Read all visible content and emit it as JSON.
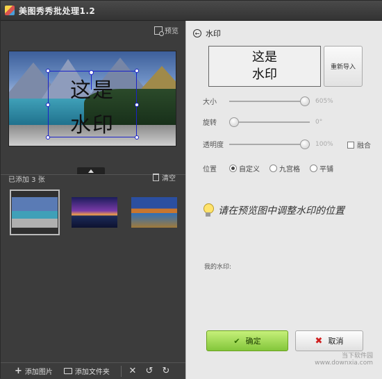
{
  "window": {
    "title": "美图秀秀批处理1.2"
  },
  "left": {
    "preview_label": "预览",
    "watermark_lines": [
      "这是",
      "水印"
    ],
    "added_label": "已添加 3 张",
    "clear_label": "清空",
    "thumbnails": [
      {
        "name": "lake-mountains",
        "selected": true
      },
      {
        "name": "sunset-island",
        "selected": false
      },
      {
        "name": "lake-reflection",
        "selected": false
      }
    ],
    "add_image_label": "添加图片",
    "add_folder_label": "添加文件夹",
    "icons": {
      "delete": "close-icon",
      "undo": "rotate-left-icon",
      "redo": "rotate-right-icon"
    }
  },
  "right": {
    "section_title": "水印",
    "watermark_preview_lines": [
      "这是",
      "水印"
    ],
    "reimport_label": "重新导入",
    "size": {
      "label": "大小",
      "value": "605%",
      "level": 0.95
    },
    "rotate": {
      "label": "旋转",
      "value": "0°",
      "level": 0.0
    },
    "opacity": {
      "label": "透明度",
      "value": "100%",
      "level": 0.95
    },
    "blend_label": "融合",
    "position": {
      "label": "位置",
      "options": [
        "自定义",
        "九宫格",
        "平铺"
      ],
      "selected": 0
    },
    "hint": "请在预览图中调整水印的位置",
    "my_watermark_label": "我的水印:",
    "ok_label": "确定",
    "cancel_label": "取消",
    "site_logo": "当下软件园\nwww.downxia.com"
  },
  "colors": {
    "ok_green": "#83c63a",
    "cancel_red": "#d02020",
    "handle_blue": "#1a22c8"
  }
}
